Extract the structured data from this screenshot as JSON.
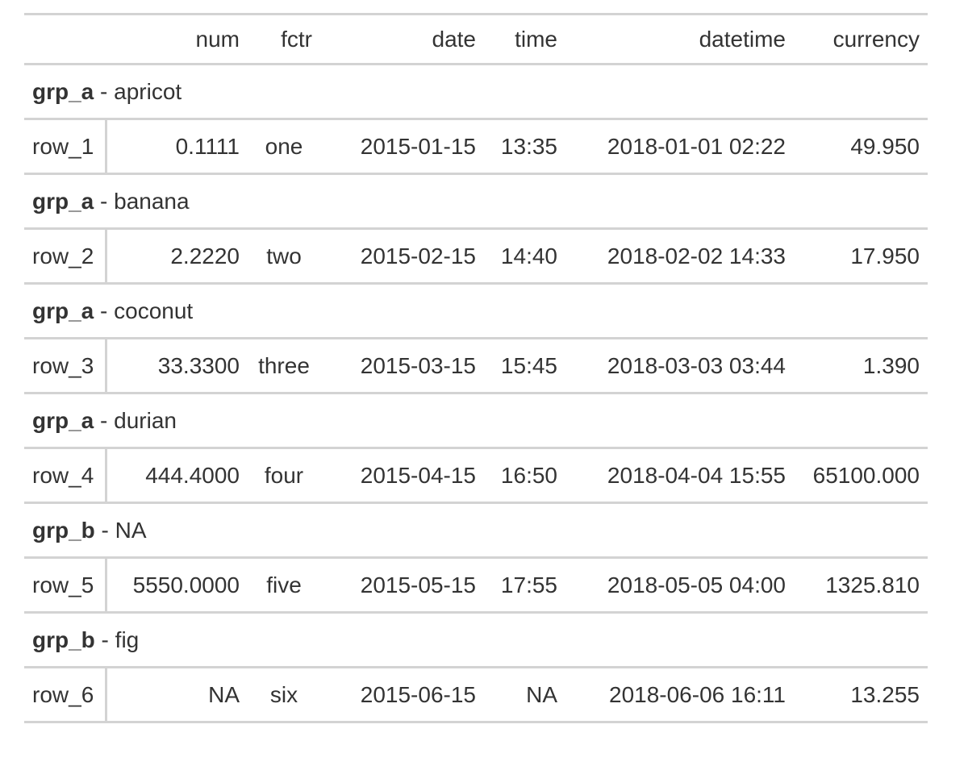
{
  "table": {
    "columns": [
      "",
      "num",
      "fctr",
      "date",
      "time",
      "datetime",
      "currency"
    ],
    "groups": [
      {
        "group": "grp_a",
        "separator": " - ",
        "label": "apricot",
        "rows": [
          {
            "stub": "row_1",
            "num": "0.1111",
            "fctr": "one",
            "date": "2015-01-15",
            "time": "13:35",
            "datetime": "2018-01-01 02:22",
            "currency": "49.950"
          }
        ]
      },
      {
        "group": "grp_a",
        "separator": " - ",
        "label": "banana",
        "rows": [
          {
            "stub": "row_2",
            "num": "2.2220",
            "fctr": "two",
            "date": "2015-02-15",
            "time": "14:40",
            "datetime": "2018-02-02 14:33",
            "currency": "17.950"
          }
        ]
      },
      {
        "group": "grp_a",
        "separator": " - ",
        "label": "coconut",
        "rows": [
          {
            "stub": "row_3",
            "num": "33.3300",
            "fctr": "three",
            "date": "2015-03-15",
            "time": "15:45",
            "datetime": "2018-03-03 03:44",
            "currency": "1.390"
          }
        ]
      },
      {
        "group": "grp_a",
        "separator": " - ",
        "label": "durian",
        "rows": [
          {
            "stub": "row_4",
            "num": "444.4000",
            "fctr": "four",
            "date": "2015-04-15",
            "time": "16:50",
            "datetime": "2018-04-04 15:55",
            "currency": "65100.000"
          }
        ]
      },
      {
        "group": "grp_b",
        "separator": " - ",
        "label": "NA",
        "rows": [
          {
            "stub": "row_5",
            "num": "5550.0000",
            "fctr": "five",
            "date": "2015-05-15",
            "time": "17:55",
            "datetime": "2018-05-05 04:00",
            "currency": "1325.810"
          }
        ]
      },
      {
        "group": "grp_b",
        "separator": " - ",
        "label": "fig",
        "rows": [
          {
            "stub": "row_6",
            "num": "NA",
            "fctr": "six",
            "date": "2015-06-15",
            "time": "NA",
            "datetime": "2018-06-06 16:11",
            "currency": "13.255"
          }
        ]
      }
    ]
  },
  "colors": {
    "text": "#333333",
    "rule": "#d3d3d3",
    "background": "#ffffff"
  }
}
